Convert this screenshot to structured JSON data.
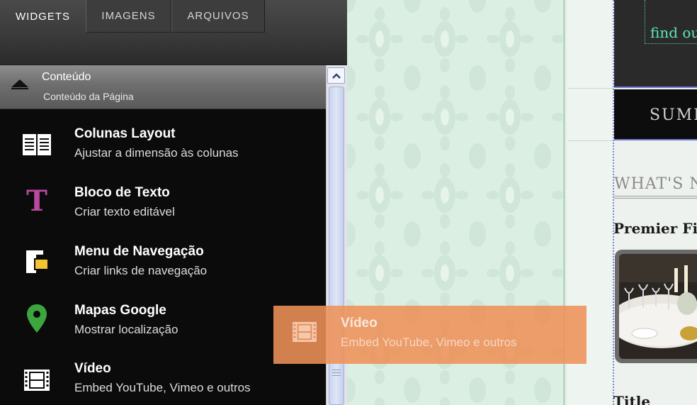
{
  "tabs": [
    {
      "label": "WIDGETS",
      "active": true
    },
    {
      "label": "IMAGENS",
      "active": false
    },
    {
      "label": "ARQUIVOS",
      "active": false
    }
  ],
  "section": {
    "title": "Conteúdo",
    "subtitle": "Conteúdo da Página",
    "icon": "collapse-arrow-icon"
  },
  "widgets": [
    {
      "title": "Colunas Layout",
      "subtitle": "Ajustar a dimensão às colunas",
      "icon": "columns-layout-icon"
    },
    {
      "title": "Bloco de Texto",
      "subtitle": "Criar texto editável",
      "icon": "text-block-icon",
      "color": "#b94aa0"
    },
    {
      "title": "Menu de Navegação",
      "subtitle": "Criar links de navegação",
      "icon": "navigation-menu-icon",
      "color": "#f4c431"
    },
    {
      "title": "Mapas Google",
      "subtitle": "Mostrar localização",
      "icon": "map-pin-icon",
      "color": "#3da53f"
    },
    {
      "title": "Vídeo",
      "subtitle": "Embed YouTube, Vimeo e outros",
      "icon": "film-strip-icon"
    }
  ],
  "drag_ghost": {
    "title": "Vídeo",
    "subtitle": "Embed YouTube, Vimeo e outros",
    "icon": "film-strip-icon",
    "color": "#ee9258"
  },
  "site_preview": {
    "find_text": "find ou",
    "nav_text": "SUMI",
    "section_heading": "WHAT'S N",
    "article_title": "Premier Fi",
    "footer_title": "Title"
  },
  "colors": {
    "panel_bg": "#0b0b0b",
    "accent_drag": "#ee9258",
    "mint": "#5de8b5"
  }
}
